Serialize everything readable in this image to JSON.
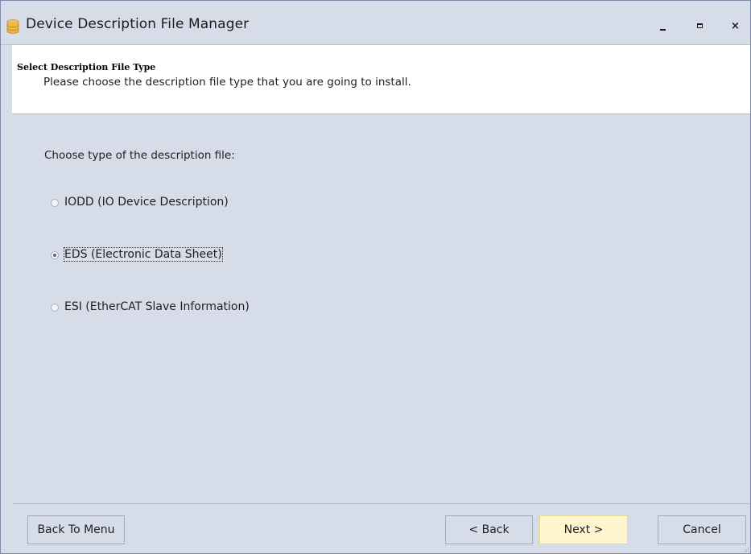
{
  "window": {
    "title": "Device Description File Manager",
    "icon": "database-icon",
    "controls": {
      "minimize": "minimize-icon",
      "maximize": "maximize-icon",
      "close": "×"
    }
  },
  "header": {
    "title": "Select Description File Type",
    "description": "Please choose the description file type that you are going to install."
  },
  "content": {
    "prompt": "Choose type of the description file:",
    "options": [
      {
        "label": "IODD (IO Device Description)",
        "selected": false
      },
      {
        "label": "EDS (Electronic Data Sheet)",
        "selected": true
      },
      {
        "label": "ESI (EtherCAT Slave Information)",
        "selected": false
      }
    ]
  },
  "footer": {
    "back_to_menu": "Back To Menu",
    "back": "< Back",
    "next": "Next >",
    "cancel": "Cancel"
  },
  "colors": {
    "background": "#d6dde9",
    "header_bg": "#ffffff",
    "primary_button_bg": "#fff6d0"
  }
}
